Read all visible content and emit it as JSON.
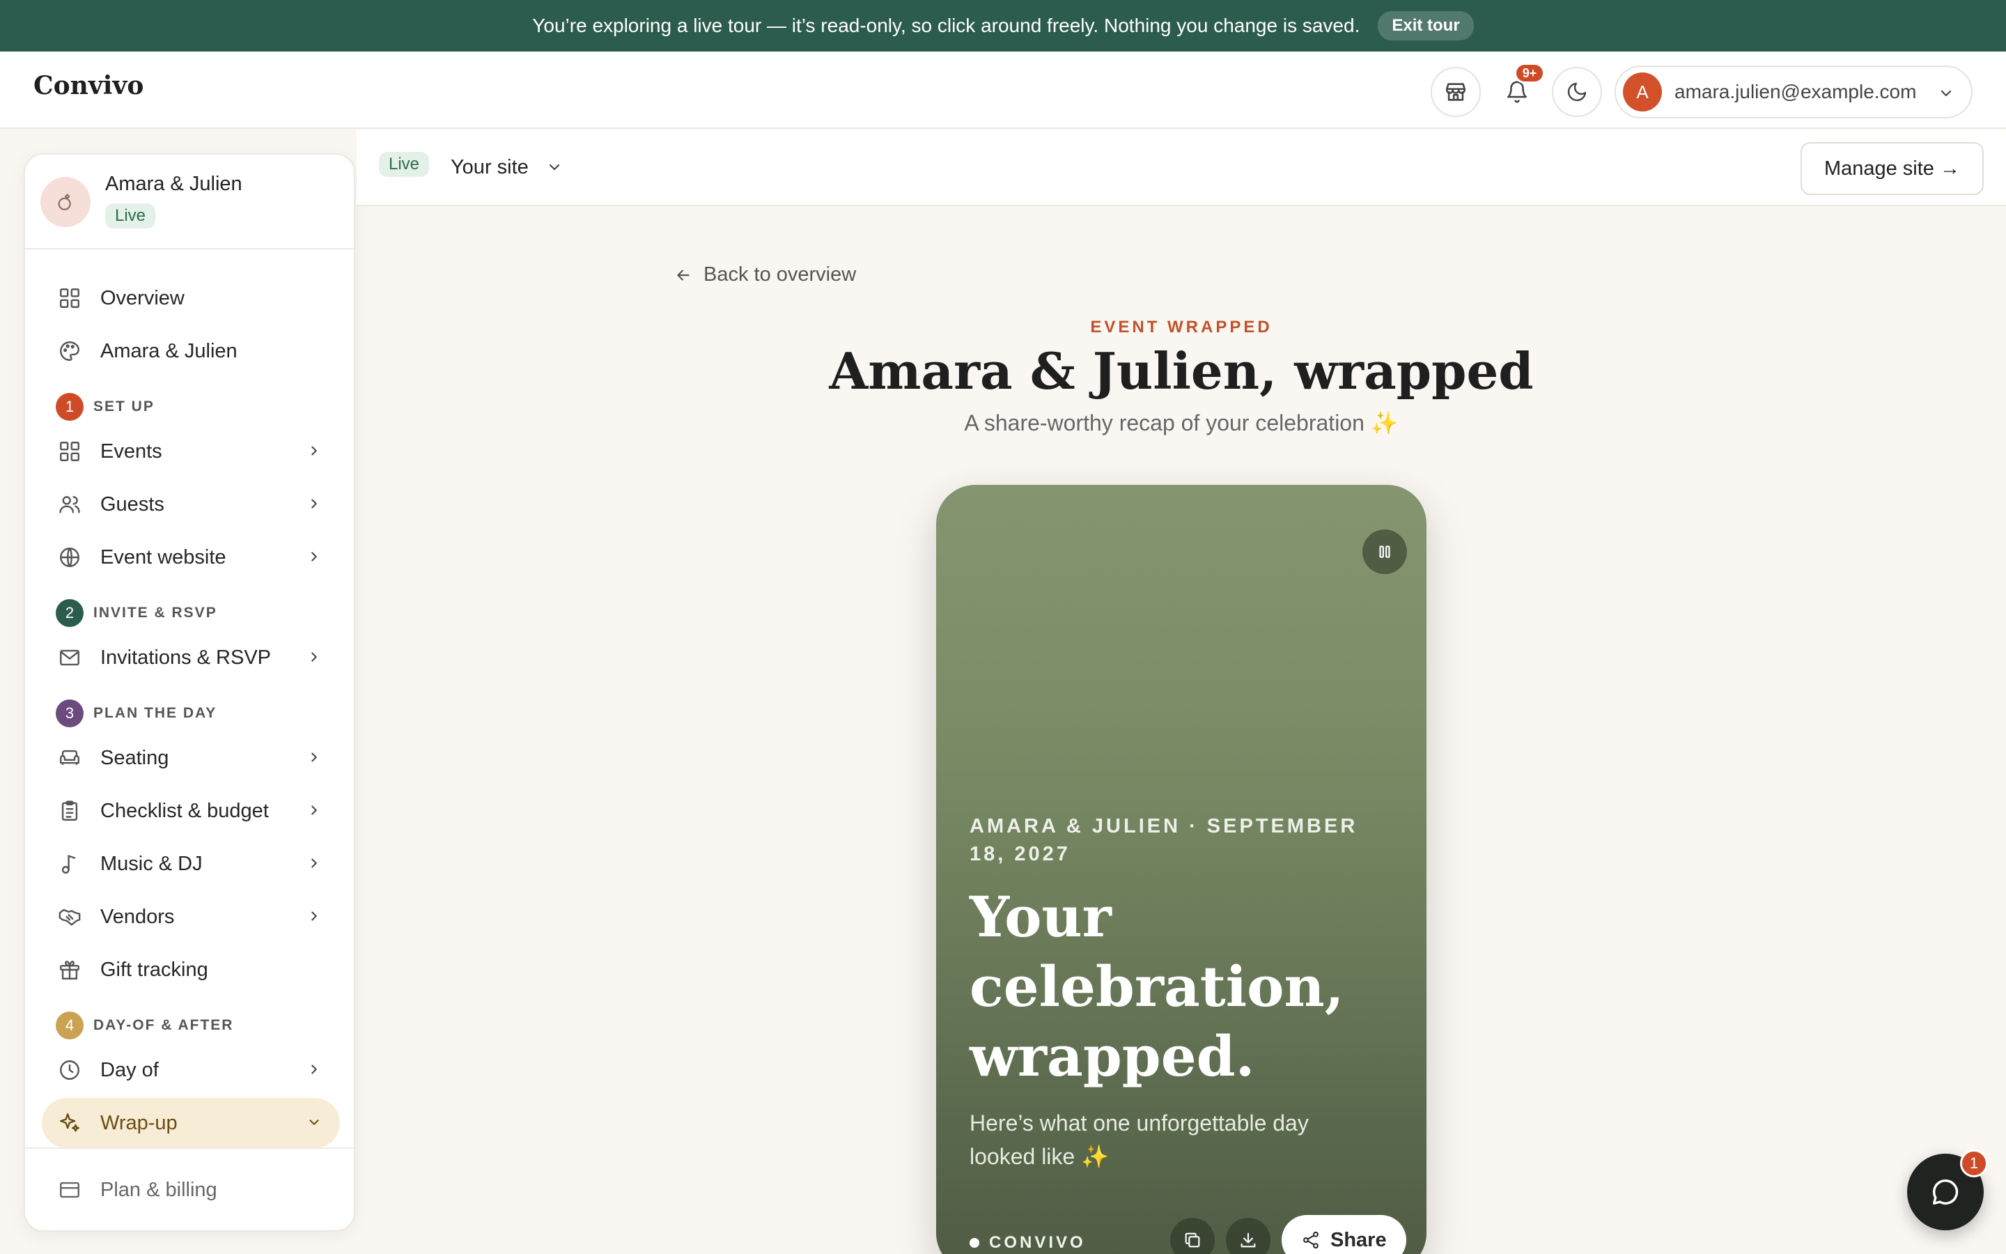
{
  "banner": {
    "message": "You’re exploring a live tour — it’s read-only, so click around freely. Nothing you change is saved.",
    "exit_label": "Exit tour"
  },
  "header": {
    "logo": "Convivo",
    "notifications_count": "9+",
    "account_initial": "A",
    "account_email": "amara.julien@example.com"
  },
  "sidebar": {
    "couple_name": "Amara & Julien",
    "status": "Live",
    "top_items": [
      {
        "label": "Overview",
        "icon": "grid-icon"
      },
      {
        "label": "Amara & Julien",
        "icon": "palette-icon"
      }
    ],
    "sections": [
      {
        "number": "1",
        "title": "SET UP",
        "color": "#cf4b27"
      },
      {
        "number": "2",
        "title": "INVITE & RSVP",
        "color": "#2c5c4d"
      },
      {
        "number": "3",
        "title": "PLAN THE DAY",
        "color": "#6b4b7e"
      },
      {
        "number": "4",
        "title": "DAY-OF & AFTER",
        "color": "#c9a352"
      }
    ],
    "items": {
      "events": "Events",
      "guests": "Guests",
      "event_website": "Event website",
      "invitations": "Invitations & RSVP",
      "seating": "Seating",
      "checklist": "Checklist & budget",
      "music": "Music & DJ",
      "vendors": "Vendors",
      "gifts": "Gift tracking",
      "day_of": "Day of",
      "wrap_up": "Wrap-up"
    },
    "footer_item": "Plan & billing"
  },
  "sitebar": {
    "status": "Live",
    "label": "Your site",
    "manage_label": "Manage site →"
  },
  "main": {
    "back_label": "Back to overview",
    "eyebrow": "EVENT WRAPPED",
    "title": "Amara & Julien, wrapped",
    "subtitle": "A share-worthy recap of your celebration ✨"
  },
  "card": {
    "meta": "AMARA & JULIEN · SEPTEMBER 18, 2027",
    "headline": "Your celebration, wrapped.",
    "body": "Here’s what one unforgettable day looked like ✨",
    "brand": "CONVIVO",
    "share_label": "Share"
  },
  "chat": {
    "badge": "1"
  },
  "colors": {
    "banner": "#2c5c4d",
    "accent": "#c1532b",
    "active_nav": "#f7edd6",
    "card_top": "#84956f",
    "card_bottom": "#4f5b44"
  }
}
